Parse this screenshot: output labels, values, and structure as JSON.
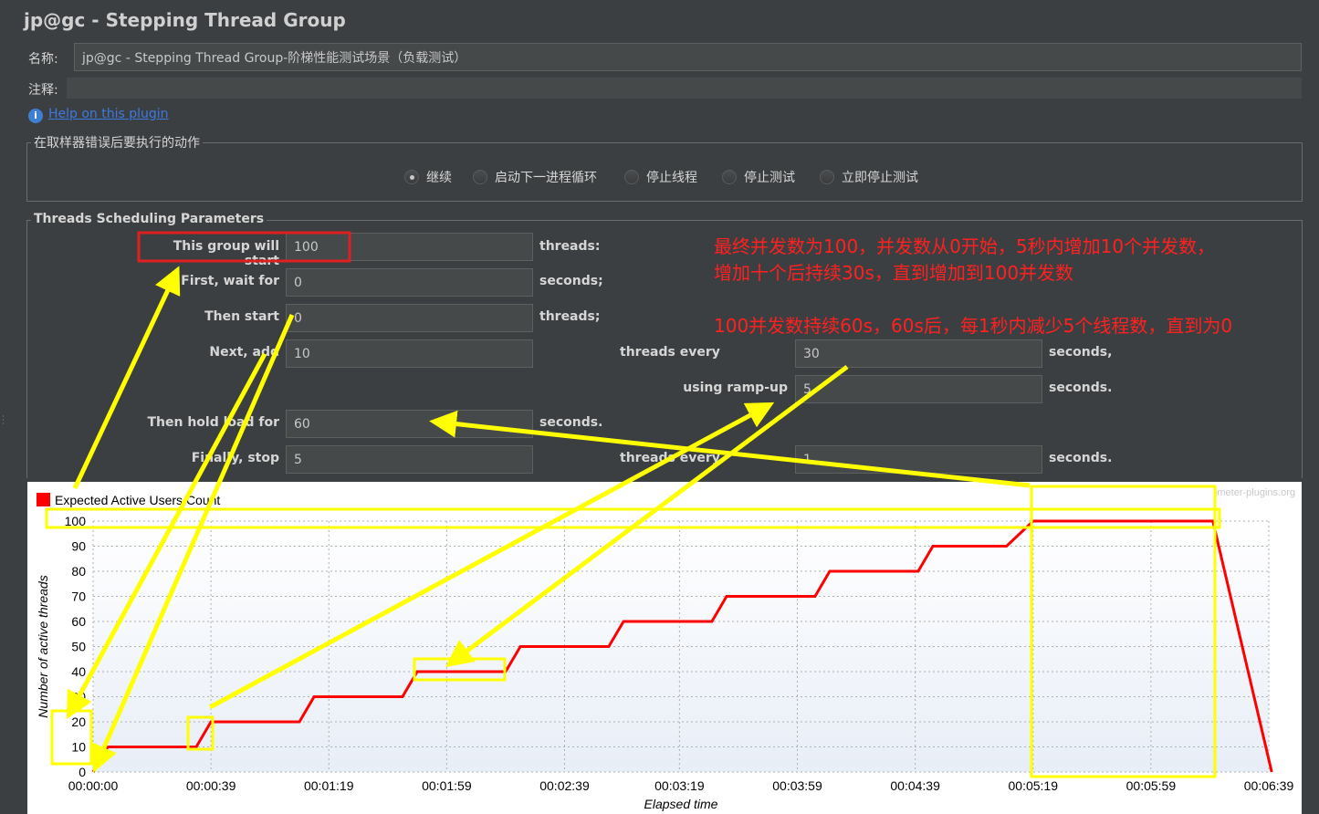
{
  "window": {
    "title": "jp@gc - Stepping Thread Group"
  },
  "name_row": {
    "label": "名称:",
    "value": "jp@gc - Stepping Thread Group-阶梯性能测试场景（负载测试）"
  },
  "comment_row": {
    "label": "注释:",
    "value": ""
  },
  "help": {
    "link": "Help on this plugin",
    "icon": "info-icon"
  },
  "error_action": {
    "title": "在取样器错误后要执行的动作",
    "options": [
      "继续",
      "启动下一进程循环",
      "停止线程",
      "停止测试",
      "立即停止测试"
    ],
    "selected": 0
  },
  "scheduling": {
    "title": "Threads Scheduling Parameters",
    "start_label": "This group will start",
    "start_value": "100",
    "start_unit": "threads:",
    "wait_label": "First, wait for",
    "wait_value": "0",
    "wait_unit": "seconds;",
    "then_start_label": "Then start",
    "then_start_value": "0",
    "then_start_unit": "threads;",
    "next_add_label": "Next, add",
    "next_add_value": "10",
    "threads_every_label": "threads every",
    "threads_every_value": "30",
    "threads_every_unit": "seconds,",
    "ramp_up_label": "using ramp-up",
    "ramp_up_value": "5",
    "ramp_up_unit": "seconds.",
    "hold_label": "Then hold load for",
    "hold_value": "60",
    "hold_unit": "seconds.",
    "stop_label": "Finally, stop",
    "stop_value": "5",
    "stop_every_label": "threads every",
    "stop_every_value": "1",
    "stop_every_unit": "seconds."
  },
  "annotations": {
    "line1": "最终并发数为100，并发数从0开始，5秒内增加10个并发数，",
    "line2": "增加十个后持续30s，直到增加到100并发数",
    "line3": "100并发数持续60s，60s后，每1秒内减少5个线程数，直到为0",
    "highlight_color": "#ffff00",
    "box_color": "#e02020",
    "text_color": "#ff2020"
  },
  "chart_data": {
    "type": "line",
    "watermark": "jmeter-plugins.org",
    "xlabel": "Elapsed time",
    "ylabel": "Number of active threads",
    "legend": "top-left",
    "grid": true,
    "series": [
      {
        "name": "Expected Active Users Count",
        "color": "#ff0000",
        "x": [
          0,
          5,
          35,
          40,
          70,
          75,
          105,
          110,
          140,
          145,
          175,
          180,
          210,
          215,
          245,
          250,
          280,
          285,
          310,
          319,
          380,
          400
        ],
        "y": [
          0,
          10,
          10,
          20,
          20,
          30,
          30,
          40,
          40,
          50,
          50,
          60,
          60,
          70,
          70,
          80,
          80,
          90,
          90,
          100,
          100,
          0
        ]
      }
    ],
    "xlim": [
      0,
      399
    ],
    "ylim": [
      0,
      100
    ],
    "xticks": [
      0,
      40,
      80,
      120,
      160,
      199,
      239,
      279,
      319,
      359,
      399
    ],
    "xtick_labels": [
      "00:00:00",
      "00:00:39",
      "00:01:19",
      "00:01:59",
      "00:02:39",
      "00:03:19",
      "00:03:59",
      "00:04:39",
      "00:05:19",
      "00:05:59",
      "00:06:39"
    ],
    "yticks": [
      0,
      10,
      20,
      30,
      40,
      50,
      60,
      70,
      80,
      90,
      100
    ]
  }
}
